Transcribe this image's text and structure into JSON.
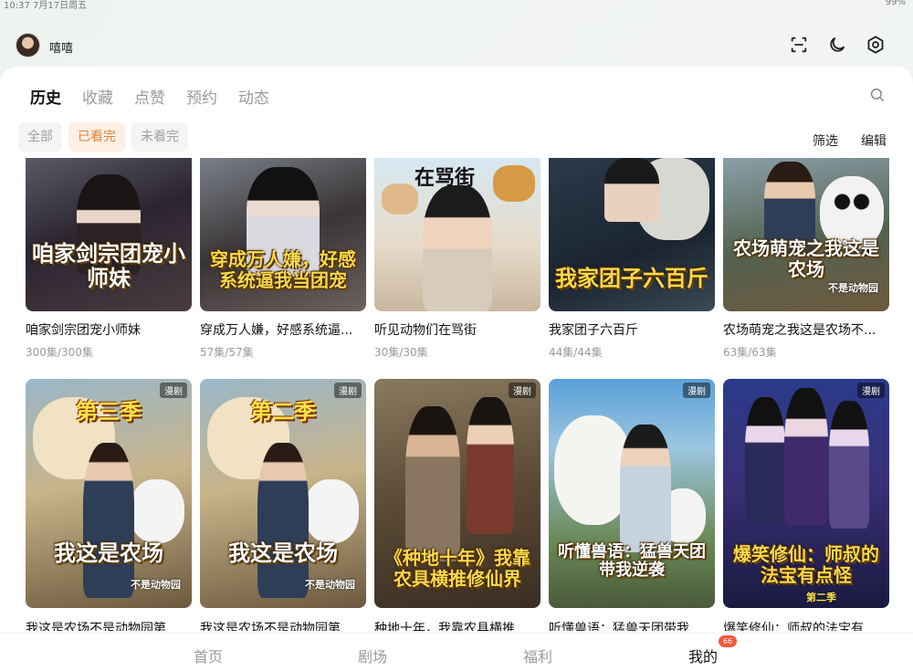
{
  "status": {
    "time": "10:37",
    "date": "7月17日周五",
    "battery": "99%"
  },
  "header": {
    "username": "嘻嘻"
  },
  "tabs": [
    {
      "label": "历史",
      "active": true
    },
    {
      "label": "收藏",
      "active": false
    },
    {
      "label": "点赞",
      "active": false
    },
    {
      "label": "预约",
      "active": false
    },
    {
      "label": "动态",
      "active": false
    }
  ],
  "filters": [
    {
      "label": "全部",
      "active": false
    },
    {
      "label": "已看完",
      "active": true
    },
    {
      "label": "未看完",
      "active": false
    }
  ],
  "tools": {
    "filter": "筛选",
    "edit": "编辑"
  },
  "row1": [
    {
      "title": "咱家剑宗团宠小师妹",
      "episodes": "300集/300集",
      "poster_text": "咱家剑宗团宠小师妹"
    },
    {
      "title": "穿成万人嫌，好感系统逼...",
      "episodes": "57集/57集",
      "poster_text": "穿成万人嫌，好感系统逼我当团宠"
    },
    {
      "title": "听见动物们在骂街",
      "episodes": "30集/30集",
      "poster_text": "在骂街"
    },
    {
      "title": "我家团子六百斤",
      "episodes": "44集/44集",
      "poster_text": "我家团子六百斤"
    },
    {
      "title": "农场萌宠之我这是农场不...",
      "episodes": "63集/63集",
      "poster_text": "农场萌宠之我这是农场",
      "poster_sub": "不是动物园"
    }
  ],
  "row2": [
    {
      "title": "我这是农场不是动物园第...",
      "badge": "漫剧",
      "season": "第三季",
      "poster_text": "我这是农场",
      "poster_sub": "不是动物园"
    },
    {
      "title": "我这是农场不是动物园第...",
      "badge": "漫剧",
      "season": "第二季",
      "poster_text": "我这是农场",
      "poster_sub": "不是动物园"
    },
    {
      "title": "种地十年，我靠农具横推...",
      "badge": "漫剧",
      "poster_text": "《种地十年》我靠农具横推修仙界"
    },
    {
      "title": "听懂兽语：猛兽天团带我...",
      "badge": "漫剧",
      "poster_text": "听懂兽语：猛兽天团带我逆袭"
    },
    {
      "title": "爆笑修仙：师叔的法宝有...",
      "badge": "漫剧",
      "poster_text": "爆笑修仙：师叔的法宝有点怪",
      "poster_sub": "第二季"
    }
  ],
  "nav": [
    {
      "label": "首页",
      "active": false
    },
    {
      "label": "剧场",
      "active": false
    },
    {
      "label": "福利",
      "active": false
    },
    {
      "label": "我的",
      "active": true,
      "badge": "66"
    }
  ],
  "colors": {
    "accent": "#e2813b",
    "badge": "#f2593a"
  }
}
